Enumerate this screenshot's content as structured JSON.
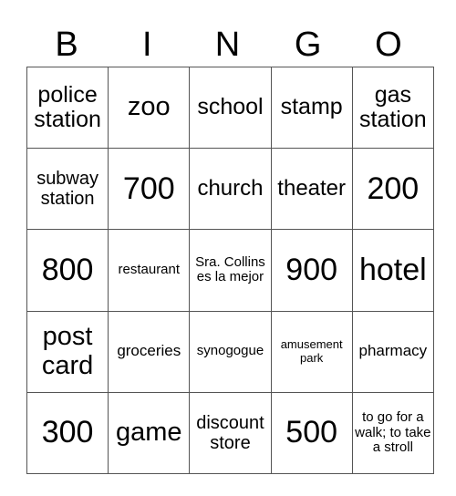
{
  "header": {
    "letters": [
      "B",
      "I",
      "N",
      "G",
      "O"
    ]
  },
  "grid": {
    "rows": [
      [
        {
          "text": "police station",
          "size": "s-ml"
        },
        {
          "text": "zoo",
          "size": "s-l"
        },
        {
          "text": "school",
          "size": "s-ml"
        },
        {
          "text": "stamp",
          "size": "s-ml"
        },
        {
          "text": "gas station",
          "size": "s-ml"
        }
      ],
      [
        {
          "text": "subway station",
          "size": "s-sm"
        },
        {
          "text": "700",
          "size": "s-xl"
        },
        {
          "text": "church",
          "size": "s-m"
        },
        {
          "text": "theater",
          "size": "s-m"
        },
        {
          "text": "200",
          "size": "s-xl"
        }
      ],
      [
        {
          "text": "800",
          "size": "s-xl"
        },
        {
          "text": "restaurant",
          "size": "s-xs"
        },
        {
          "text": "Sra. Collins es la mejor",
          "size": "s-xs"
        },
        {
          "text": "900",
          "size": "s-xl"
        },
        {
          "text": "hotel",
          "size": "s-xl"
        }
      ],
      [
        {
          "text": "post card",
          "size": "s-l lh-post"
        },
        {
          "text": "groceries",
          "size": "s-s"
        },
        {
          "text": "synogogue",
          "size": "s-xs"
        },
        {
          "text": "amusement park",
          "size": "s-xxs"
        },
        {
          "text": "pharmacy",
          "size": "s-s"
        }
      ],
      [
        {
          "text": "300",
          "size": "s-xl"
        },
        {
          "text": "game",
          "size": "s-l"
        },
        {
          "text": "discount store",
          "size": "s-sm"
        },
        {
          "text": "500",
          "size": "s-xl"
        },
        {
          "text": "to go for a walk; to take a stroll",
          "size": "s-xs"
        }
      ]
    ]
  }
}
